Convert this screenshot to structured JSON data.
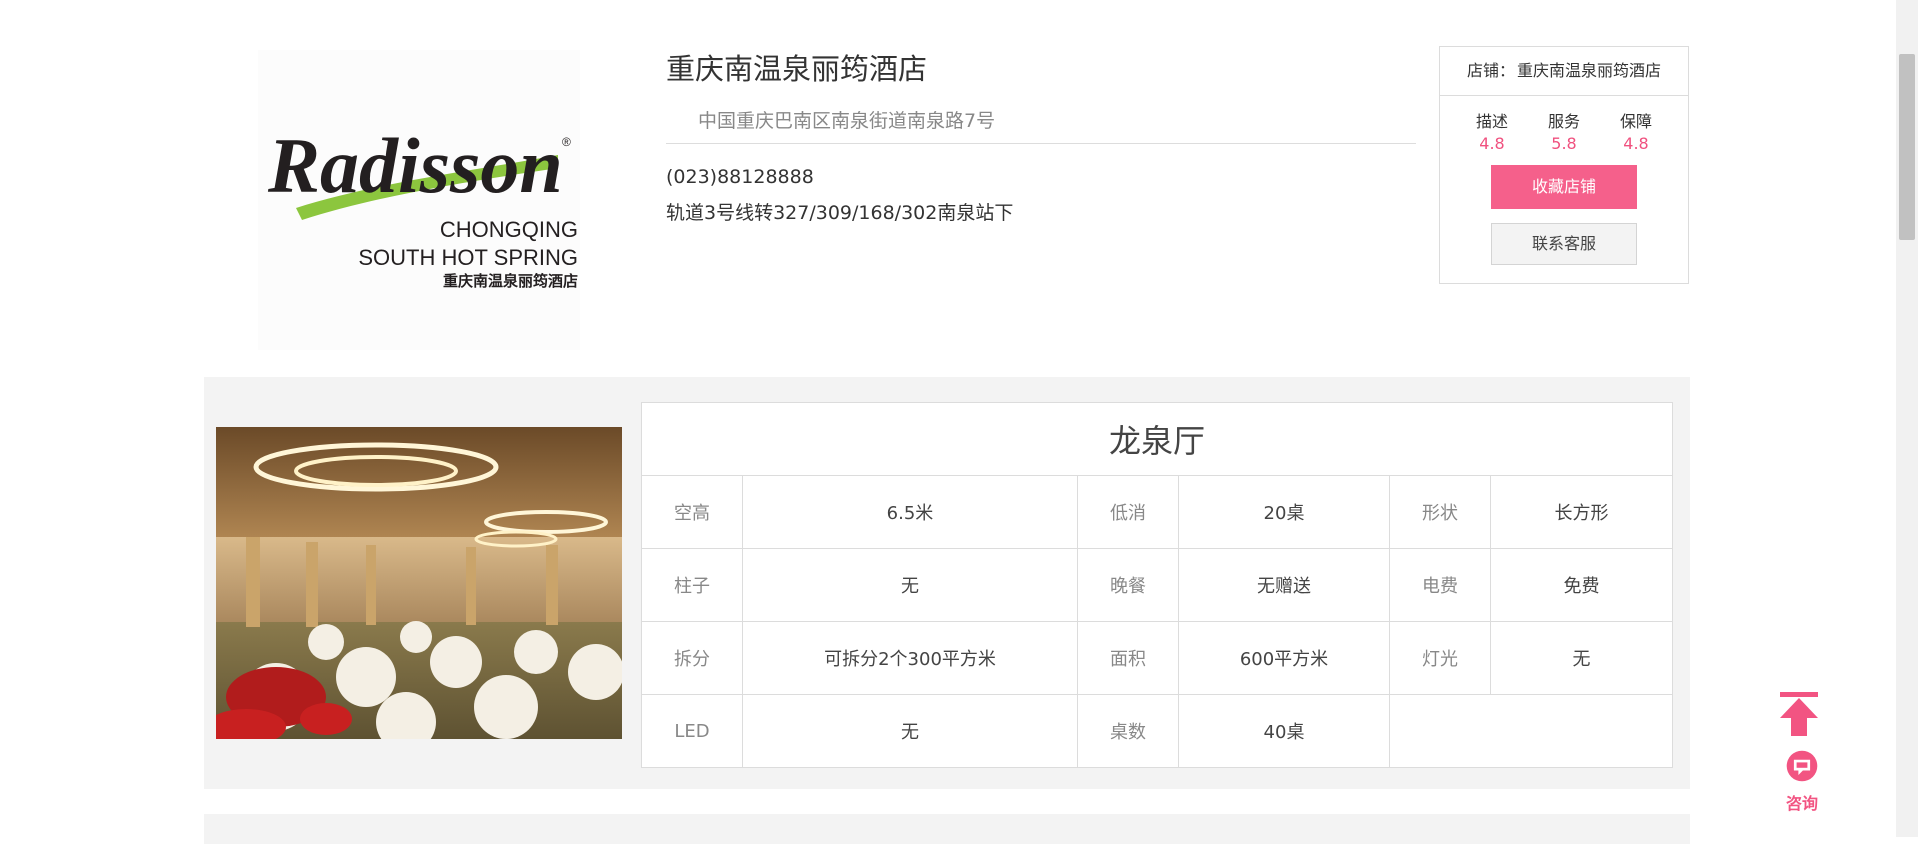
{
  "hotel": {
    "logo_text": {
      "brand": "Radisson",
      "line1": "CHONGQING",
      "line2": "SOUTH HOT SPRING",
      "line3": "重庆南温泉丽筠酒店"
    },
    "name": "重庆南温泉丽筠酒店",
    "address": "中国重庆巴南区南泉街道南泉路7号",
    "phone": "(023)88128888",
    "transport": "轨道3号线转327/309/168/302南泉站下"
  },
  "store": {
    "label": "店铺：",
    "name": "重庆南温泉丽筠酒店",
    "ratings": [
      {
        "label": "描述",
        "value": "4.8"
      },
      {
        "label": "服务",
        "value": "5.8"
      },
      {
        "label": "保障",
        "value": "4.8"
      }
    ],
    "favorite_button": "收藏店铺",
    "service_button": "联系客服"
  },
  "hall": {
    "title": "龙泉厅",
    "rows": [
      [
        {
          "k": "空高",
          "v": "6.5米"
        },
        {
          "k": "低消",
          "v": "20桌"
        },
        {
          "k": "形状",
          "v": "长方形"
        }
      ],
      [
        {
          "k": "柱子",
          "v": "无"
        },
        {
          "k": "晚餐",
          "v": "无赠送"
        },
        {
          "k": "电费",
          "v": "免费"
        }
      ],
      [
        {
          "k": "拆分",
          "v": "可拆分2个300平方米"
        },
        {
          "k": "面积",
          "v": "600平方米"
        },
        {
          "k": "灯光",
          "v": "无"
        }
      ],
      [
        {
          "k": "LED",
          "v": "无"
        },
        {
          "k": "桌数",
          "v": "40桌"
        }
      ]
    ]
  },
  "floating": {
    "consult_label": "咨询"
  },
  "colors": {
    "accent_pink": "#f5608b",
    "rating_pink": "#f0517f",
    "section_bg": "#f3f3f3"
  },
  "icons": {
    "back_to_top": "arrow-up-icon",
    "consult": "chat-bubble-icon"
  }
}
